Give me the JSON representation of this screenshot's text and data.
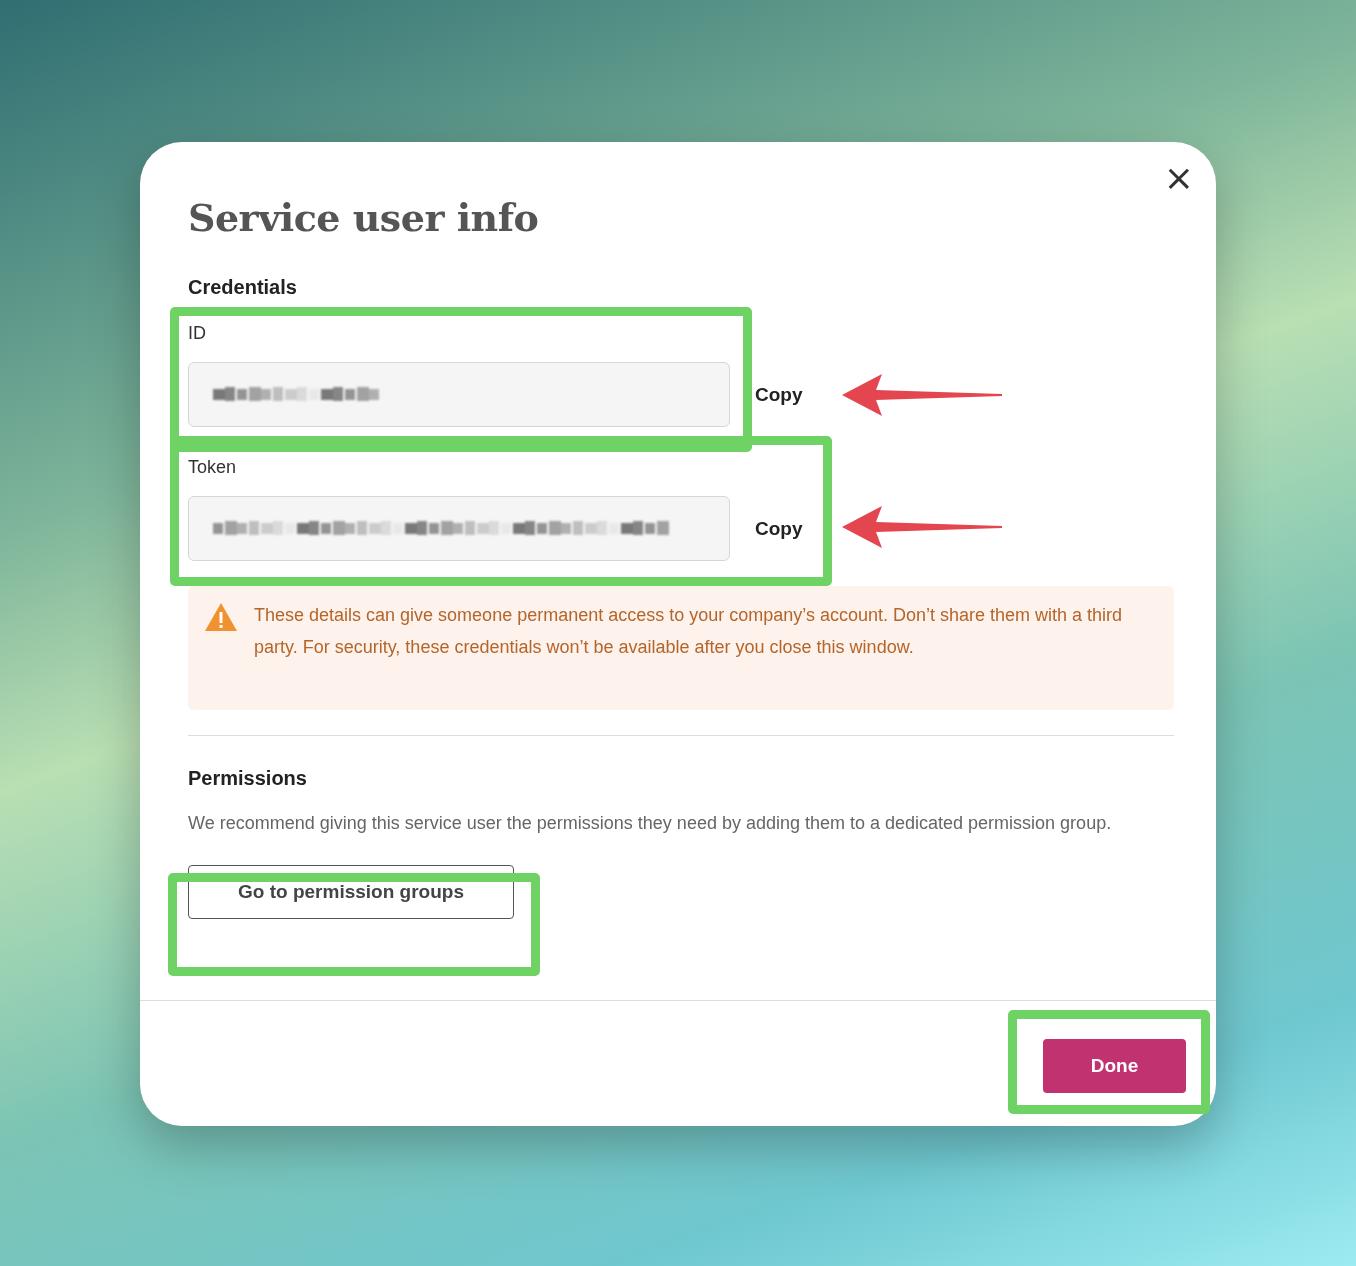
{
  "dialog": {
    "title": "Service user info",
    "close": "×",
    "credentials": {
      "heading": "Credentials",
      "fields": [
        {
          "label": "ID",
          "action": "Copy"
        },
        {
          "label": "Token",
          "action": "Copy"
        }
      ]
    },
    "warning": "These details can give someone permanent access to your company’s account. Don’t share them with a third party. For security, these credentials won’t be available after you close this window.",
    "permissions": {
      "heading": "Permissions",
      "text": "We recommend giving this service user the permissions they need by adding them to a dedicated permission group.",
      "button": "Go to permission groups"
    },
    "footer": {
      "button": "Done"
    }
  }
}
